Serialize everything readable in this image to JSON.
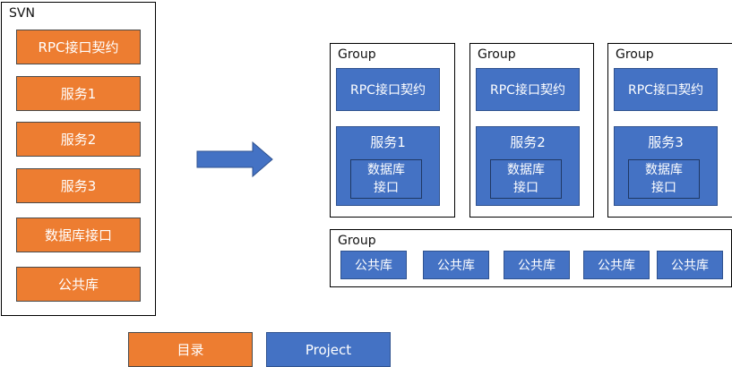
{
  "svn": {
    "title": "SVN",
    "items": [
      "RPC接口契约",
      "服务1",
      "服务2",
      "服务3",
      "数据库接口",
      "公共库"
    ]
  },
  "groups": [
    {
      "title": "Group",
      "rpc": "RPC接口契约",
      "service": "服务1",
      "db_line1": "数据库",
      "db_line2": "接口"
    },
    {
      "title": "Group",
      "rpc": "RPC接口契约",
      "service": "服务2",
      "db_line1": "数据库",
      "db_line2": "接口"
    },
    {
      "title": "Group",
      "rpc": "RPC接口契约",
      "service": "服务3",
      "db_line1": "数据库",
      "db_line2": "接口"
    }
  ],
  "common_group": {
    "title": "Group",
    "libs": [
      "公共库",
      "公共库",
      "公共库",
      "公共库",
      "公共库"
    ]
  },
  "legend": {
    "directory": "目录",
    "project": "Project"
  },
  "colors": {
    "orange": "#ED7D31",
    "blue": "#4472C4",
    "border": "#000000"
  }
}
